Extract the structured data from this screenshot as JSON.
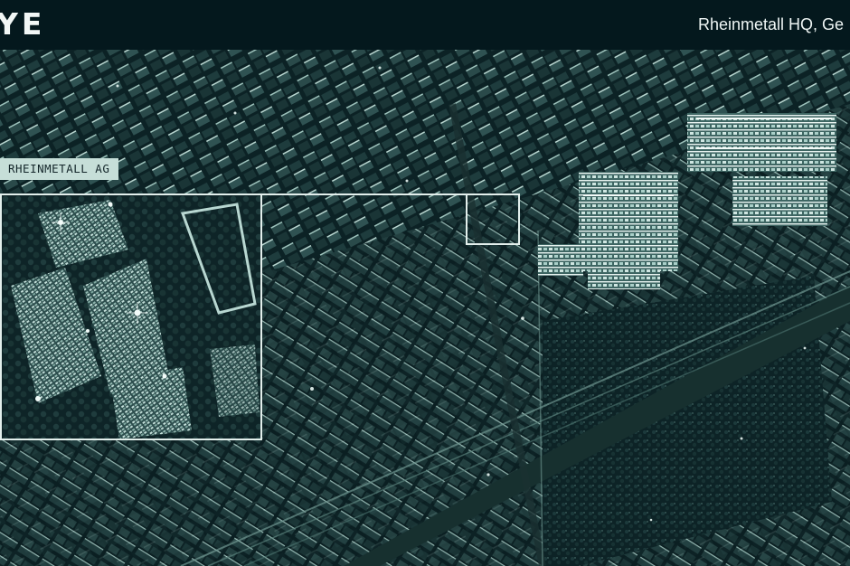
{
  "header": {
    "logo_text": "YE",
    "location": "Rheinmetall HQ, Ge"
  },
  "map": {
    "target_label": "RHEINMETALL AG",
    "image_description_icon": "sar-satellite-image"
  },
  "colors": {
    "header_bg": "#04181d",
    "imagery_base": "#0a1a1c",
    "highlight": "#e3efec",
    "label_bg": "#c6ded8"
  }
}
